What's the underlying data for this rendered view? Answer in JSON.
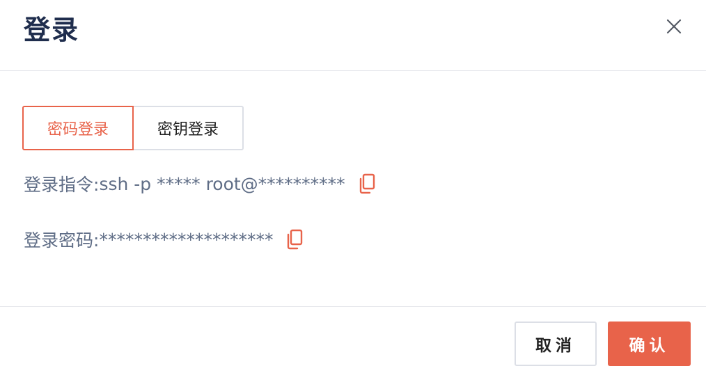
{
  "dialog": {
    "title": "登录",
    "close_icon": "close-icon"
  },
  "tabs": [
    {
      "label": "密码登录",
      "active": true
    },
    {
      "label": "密钥登录",
      "active": false
    }
  ],
  "fields": {
    "command_label": "登录指令:",
    "command_value": "ssh -p ***** root@**********",
    "password_label": "登录密码:",
    "password_value": "********************",
    "copy_icon": "copy-icon"
  },
  "footer": {
    "cancel_label": "取消",
    "ok_label": "确认"
  },
  "colors": {
    "accent": "#e8634a",
    "title": "#1f2d4d",
    "text_muted": "#5f6d86",
    "border": "#dcdfe6"
  }
}
